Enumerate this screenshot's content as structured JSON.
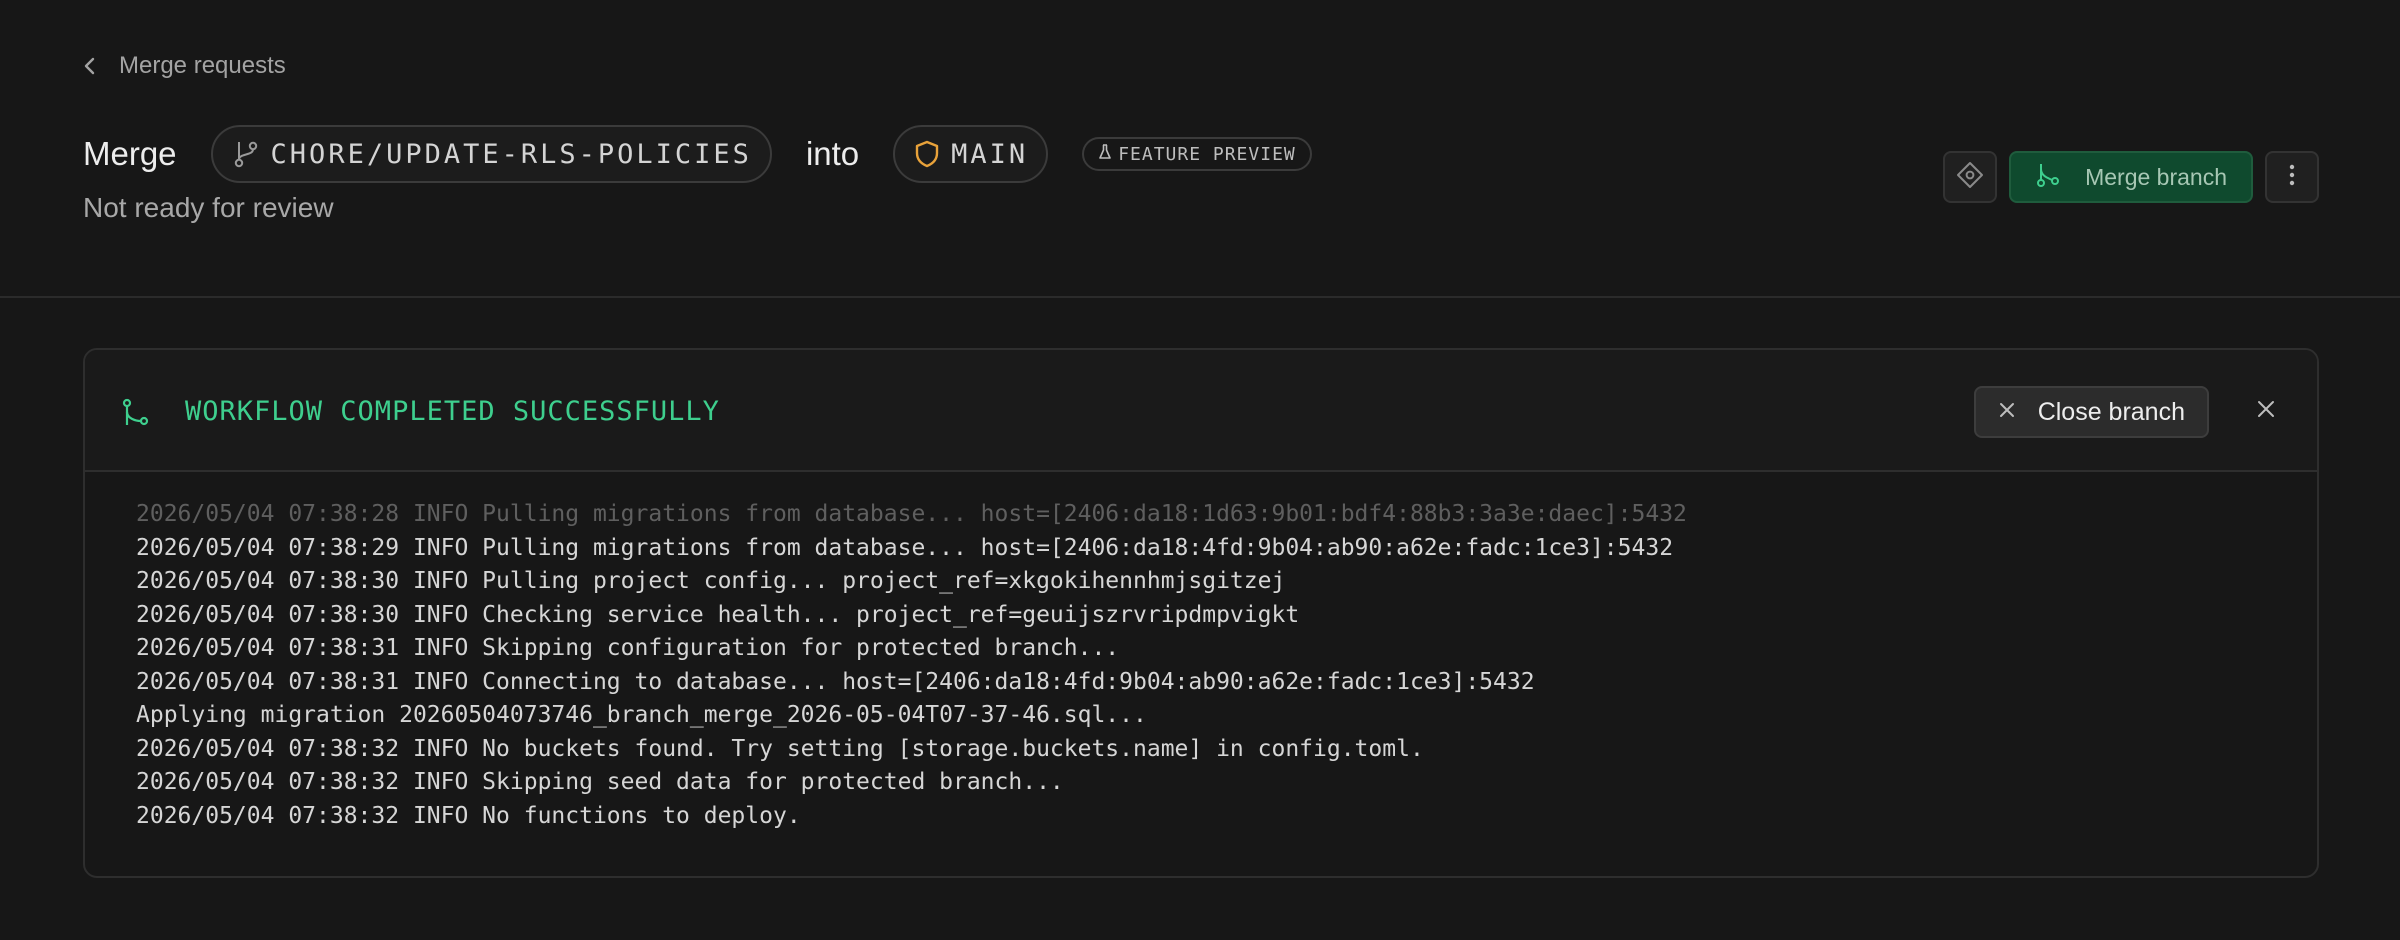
{
  "header": {
    "back_label": "Merge requests",
    "merge_word": "Merge",
    "source_branch": "CHORE/UPDATE-RLS-POLICIES",
    "into_word": "into",
    "target_branch": "MAIN",
    "preview_badge": "FEATURE PREVIEW",
    "status": "Not ready for review",
    "actions": {
      "merge_button": "Merge branch",
      "diff_icon": "diamond-icon",
      "more_icon": "kebab-menu-icon"
    }
  },
  "workflow": {
    "title": "WORKFLOW COMPLETED SUCCESSFULLY",
    "close_branch_label": "Close branch",
    "log": [
      "2026/05/04 07:38:28 INFO Pulling migrations from database... host=[2406:da18:1d63:9b01:bdf4:88b3:3a3e:daec]:5432",
      "2026/05/04 07:38:29 INFO Pulling migrations from database... host=[2406:da18:4fd:9b04:ab90:a62e:fadc:1ce3]:5432",
      "2026/05/04 07:38:30 INFO Pulling project config... project_ref=xkgokihennhmjsgitzej",
      "2026/05/04 07:38:30 INFO Checking service health... project_ref=geuijszrvripdmpvigkt",
      "2026/05/04 07:38:31 INFO Skipping configuration for protected branch...",
      "2026/05/04 07:38:31 INFO Connecting to database... host=[2406:da18:4fd:9b04:ab90:a62e:fadc:1ce3]:5432",
      "Applying migration 20260504073746_branch_merge_2026-05-04T07-37-46.sql...",
      "2026/05/04 07:38:32 INFO No buckets found. Try setting [storage.buckets.name] in config.toml.",
      "2026/05/04 07:38:32 INFO Skipping seed data for protected branch...",
      "2026/05/04 07:38:32 INFO No functions to deploy."
    ]
  },
  "colors": {
    "background": "#171717",
    "accent_green": "#3ecf8e",
    "merge_button_bg": "#0f4a2e",
    "shield_orange": "#e8a23a"
  }
}
